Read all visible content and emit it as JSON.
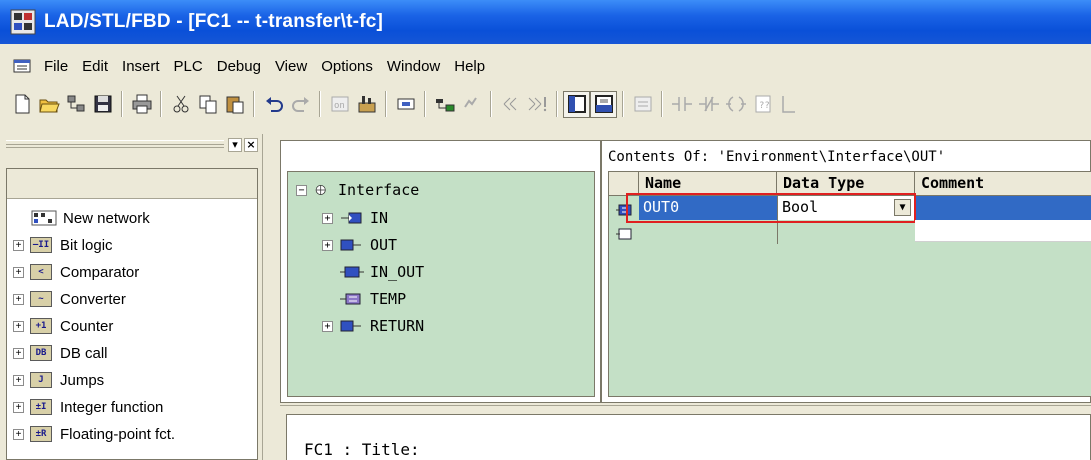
{
  "window": {
    "title": "LAD/STL/FBD  - [FC1 -- t-transfer\\t-fc]"
  },
  "menu": [
    "File",
    "Edit",
    "Insert",
    "PLC",
    "Debug",
    "View",
    "Options",
    "Window",
    "Help"
  ],
  "toolbar": {
    "icons": [
      "new-icon",
      "open-icon",
      "accessible-nodes-icon",
      "save-icon",
      "print-icon",
      "cut-icon",
      "copy-icon",
      "paste-icon",
      "undo-icon",
      "redo-icon",
      "compare-icon",
      "download-icon",
      "overview-icon",
      "simulation-icon",
      "monitor-icon",
      "previous-icon",
      "next-icon",
      "program-elements-icon",
      "details-icon",
      "network-icon",
      "no-contact-icon",
      "nc-contact-icon",
      "coil-icon",
      "empty-box-icon",
      "branch-icon"
    ]
  },
  "elements_pane": {
    "items": [
      {
        "label": "New network",
        "icon": "new-network-icon",
        "expandable": false
      },
      {
        "label": "Bit logic",
        "icon": "bit-logic-icon",
        "abbr": "–II",
        "expandable": true
      },
      {
        "label": "Comparator",
        "icon": "comparator-icon",
        "abbr": "<",
        "expandable": true
      },
      {
        "label": "Converter",
        "icon": "converter-icon",
        "abbr": "~",
        "expandable": true
      },
      {
        "label": "Counter",
        "icon": "counter-icon",
        "abbr": "+1",
        "expandable": true
      },
      {
        "label": "DB call",
        "icon": "db-call-icon",
        "abbr": "DB",
        "expandable": true
      },
      {
        "label": "Jumps",
        "icon": "jumps-icon",
        "abbr": "J",
        "expandable": true
      },
      {
        "label": "Integer function",
        "icon": "integer-function-icon",
        "abbr": "±I",
        "expandable": true
      },
      {
        "label": "Floating-point fct.",
        "icon": "floating-point-icon",
        "abbr": "±R",
        "expandable": true
      }
    ]
  },
  "interface_tree": {
    "root": "Interface",
    "children": [
      {
        "label": "IN",
        "expandable": true
      },
      {
        "label": "OUT",
        "expandable": true
      },
      {
        "label": "IN_OUT",
        "expandable": false
      },
      {
        "label": "TEMP",
        "expandable": false
      },
      {
        "label": "RETURN",
        "expandable": true
      }
    ]
  },
  "contents": {
    "caption": "Contents Of: 'Environment\\Interface\\OUT'",
    "columns": [
      "Name",
      "Data Type",
      "Comment"
    ],
    "rows": [
      {
        "name": "OUT0",
        "data_type": "Bool",
        "comment": ""
      }
    ]
  },
  "code": {
    "network_title": "FC1 : Title:"
  },
  "colors": {
    "title_bar": "#0a50d8",
    "selection": "#316ac5",
    "highlight_border": "#e02020",
    "pane_green": "#c4e0c6"
  }
}
